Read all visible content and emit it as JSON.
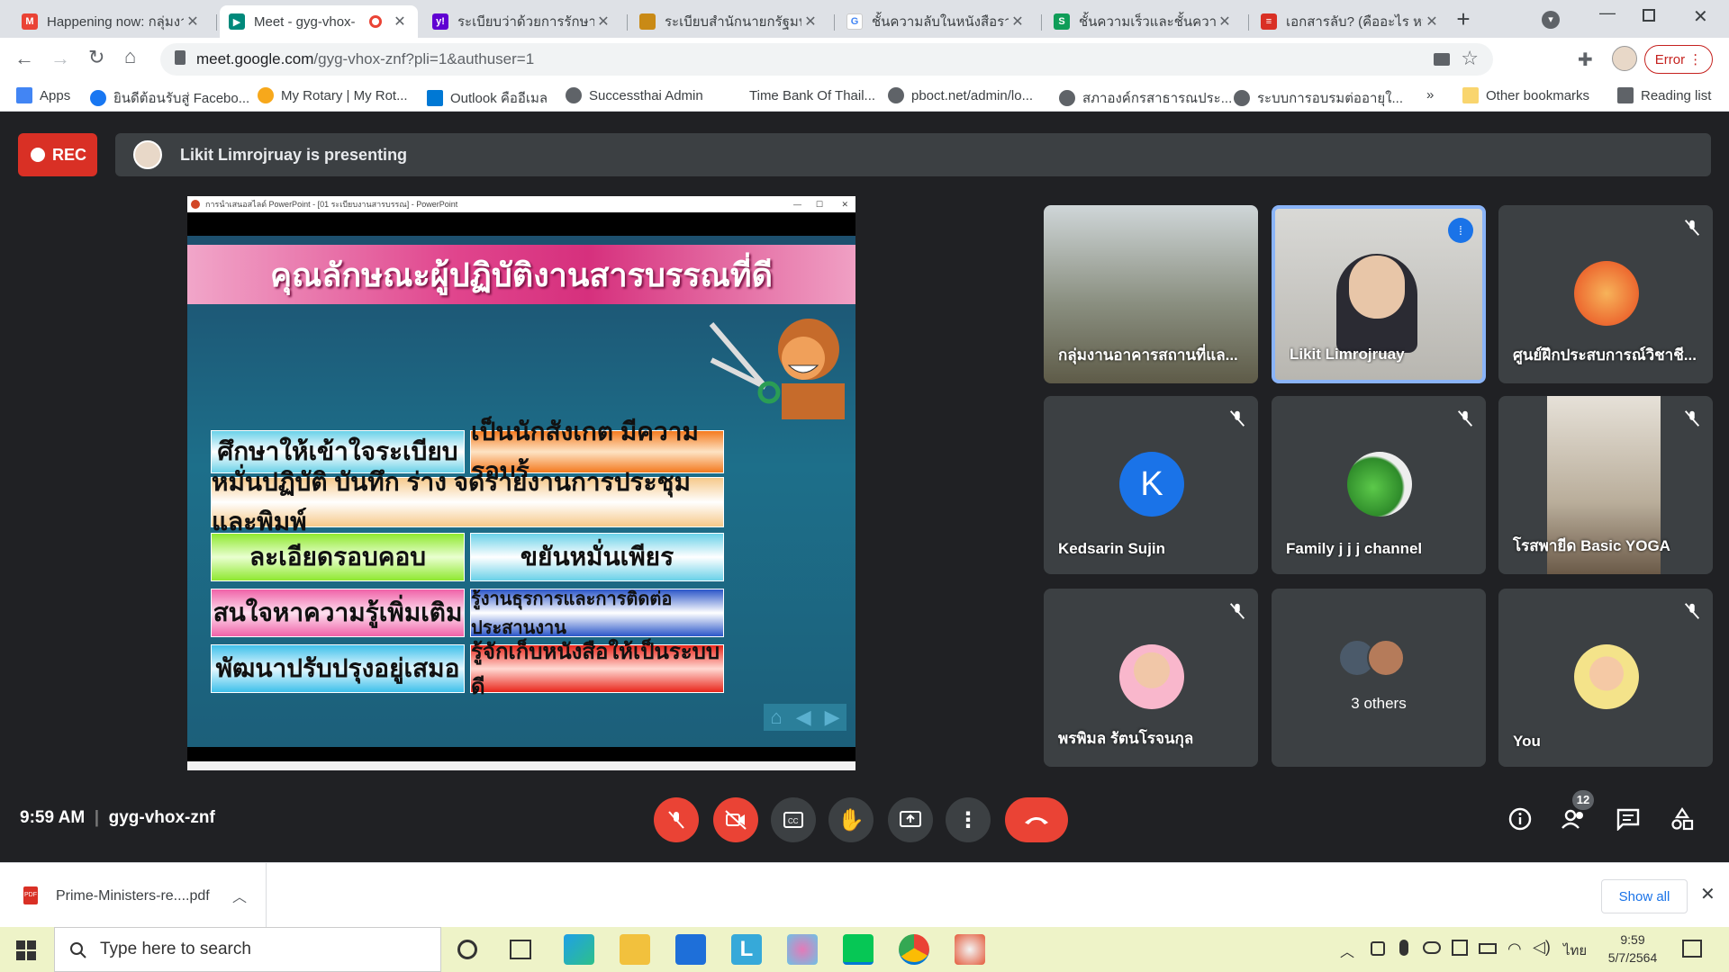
{
  "tabs": [
    {
      "title": "Happening now: กลุ่มงา",
      "icon": "gmail-icon",
      "color": "#ea4335"
    },
    {
      "title": "Meet - gyg-vhox-",
      "icon": "meet-icon",
      "color": "#00897b",
      "active": true
    },
    {
      "title": "ระเบียบว่าด้วยการรักษาค",
      "icon": "yahoo-icon",
      "color": "#6001d2"
    },
    {
      "title": "ระเบียบสำนักนายกรัฐมนต",
      "icon": "thai-gov-icon",
      "color": "#c98a16"
    },
    {
      "title": "ชั้นความลับในหนังสือราช",
      "icon": "google-icon",
      "color": "#4285f4"
    },
    {
      "title": "ชั้นความเร็วและชั้นความลั",
      "icon": "slide-icon",
      "color": "#0f9d58"
    },
    {
      "title": "เอกสารลับ? (คืออะไร หมา",
      "icon": "doc-icon",
      "color": "#d93025"
    }
  ],
  "address": {
    "host": "meet.google.com",
    "path": "/gyg-vhox-znf?pli=1&authuser=1"
  },
  "profile_error": "Error",
  "bookmarks": {
    "items": [
      {
        "label": "Apps",
        "color": "#4285f4"
      },
      {
        "label": "ยินดีต้อนรับสู่ Facebo...",
        "color": "#1877f2"
      },
      {
        "label": "My Rotary | My Rot...",
        "color": "#f7a81b"
      },
      {
        "label": "Outlook คืออีเมล",
        "color": "#0078d4"
      },
      {
        "label": "Successthai Admin",
        "color": "#5f6368"
      },
      {
        "label": "Time Bank Of Thail...",
        "color": "#ffffff"
      },
      {
        "label": "pboct.net/admin/lo...",
        "color": "#5f6368"
      },
      {
        "label": "สภาองค์กรสาธารณประ...",
        "color": "#5f6368"
      },
      {
        "label": "ระบบการอบรมต่ออายุใ...",
        "color": "#5f6368"
      }
    ],
    "more": "»",
    "other": "Other bookmarks",
    "reading": "Reading list"
  },
  "meet": {
    "rec_label": "REC",
    "presenting": "Likit Limrojruay is presenting",
    "slide_window_title": "การนำเสนอสไลด์ PowerPoint - [01 ระเบียบงานสารบรรณ] - PowerPoint",
    "slide": {
      "title": "คุณลักษณะผู้ปฏิบัติงานสารบรรณที่ดี",
      "cells": [
        "ศึกษาให้เข้าใจระเบียบ",
        "เป็นนักสังเกต มีความรอบรู้",
        "หมั่นปฏิบัติ บันทึก ร่าง จดรายงานการประชุม และพิมพ์",
        "ละเอียดรอบคอบ",
        "ขยันหมั่นเพียร",
        "สนใจหาความรู้เพิ่มเติม",
        "รู้งานธุรการและการติดต่อประสานงาน",
        "พัฒนาปรับปรุงอยู่เสมอ",
        "รู้จักเก็บหนังสือให้เป็นระบบดี"
      ]
    },
    "participants": [
      {
        "name": "กลุ่มงานอาคารสถานที่แล...",
        "type": "video-room",
        "muted": false
      },
      {
        "name": "Likit Limrojruay",
        "type": "video-person",
        "speaking": true
      },
      {
        "name": "ศูนย์ฝึกประสบการณ์วิชาชี...",
        "type": "avatar",
        "muted": true
      },
      {
        "name": "Kedsarin Sujin",
        "type": "letter",
        "letter": "K",
        "muted": true
      },
      {
        "name": "Family j j j channel",
        "type": "avatar",
        "muted": true
      },
      {
        "name": "โรสพายีด Basic YOGA",
        "type": "video-yoga",
        "muted": true
      },
      {
        "name": "พรพิมล รัตนโรจนกุล",
        "type": "avatar",
        "muted": true
      },
      {
        "name": "3 others",
        "type": "others"
      },
      {
        "name": "You",
        "type": "avatar",
        "muted": true
      }
    ],
    "time": "9:59 AM",
    "meeting_code": "gyg-vhox-znf",
    "people_count": "12"
  },
  "download": {
    "file": "Prime-Ministers-re....pdf",
    "show_all": "Show all"
  },
  "taskbar": {
    "search_placeholder": "Type here to search",
    "time": "9:59",
    "date": "5/7/2564",
    "lang": "ไทย"
  }
}
